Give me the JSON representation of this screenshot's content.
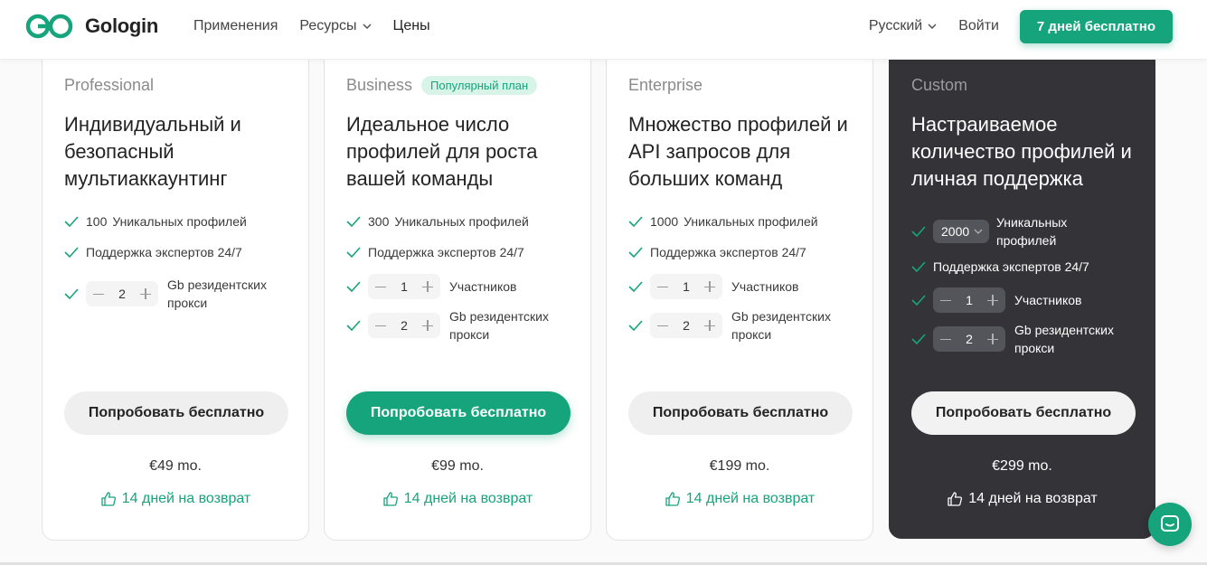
{
  "header": {
    "logo_text": "Gologin",
    "nav": [
      "Применения",
      "Ресурсы",
      "Цены"
    ],
    "language": "Русский",
    "login": "Войти",
    "cta": "7 дней бесплатно"
  },
  "colors": {
    "brand": "#15a47b",
    "dark_card": "#333338"
  },
  "plans": [
    {
      "name": "Professional",
      "title": "Индивидуальный и безопасный мультиаккаунтинг",
      "profiles_count": "100",
      "profiles_label": "Уникальных профилей",
      "support": "Поддержка экспертов 24/7",
      "proxy_value": "2",
      "proxy_label": "Gb резидентских прокси",
      "button": "Попробовать бесплатно",
      "price": "€49 mo.",
      "refund": "14 дней на возврат"
    },
    {
      "name": "Business",
      "badge": "Популярный план",
      "title": "Идеальное число профилей для роста вашей команды",
      "profiles_count": "300",
      "profiles_label": "Уникальных профилей",
      "support": "Поддержка экспертов 24/7",
      "members_value": "1",
      "members_label": "Участников",
      "proxy_value": "2",
      "proxy_label": "Gb резидентских прокси",
      "button": "Попробовать бесплатно",
      "price": "€99 mo.",
      "refund": "14 дней на возврат"
    },
    {
      "name": "Enterprise",
      "title": "Множество профилей и API запросов для больших команд",
      "profiles_count": "1000",
      "profiles_label": "Уникальных профилей",
      "support": "Поддержка экспертов 24/7",
      "members_value": "1",
      "members_label": "Участников",
      "proxy_value": "2",
      "proxy_label": "Gb резидентских прокси",
      "button": "Попробовать бесплатно",
      "price": "€199 mo.",
      "refund": "14 дней на возврат"
    },
    {
      "name": "Custom",
      "title": "Настраиваемое количество профилей и личная поддержка",
      "profiles_select": "2000",
      "profiles_label": "Уникальных профилей",
      "support": "Поддержка экспертов 24/7",
      "members_value": "1",
      "members_label": "Участников",
      "proxy_value": "2",
      "proxy_label": "Gb резидентских прокси",
      "button": "Попробовать бесплатно",
      "price": "€299 mo.",
      "refund": "14 дней на возврат"
    }
  ]
}
